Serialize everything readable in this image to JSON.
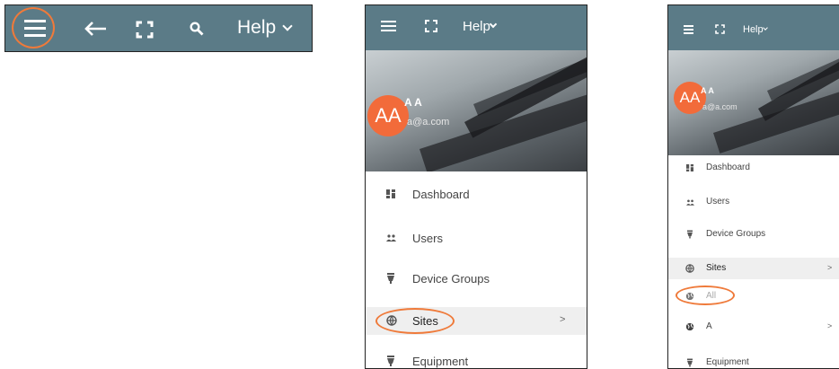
{
  "colors": {
    "toolbar_bg": "#5b7b87",
    "highlight_ring": "#ef7a3a",
    "avatar_bg": "#f26b3a",
    "active_row_bg": "#efefef"
  },
  "icons": {
    "menu": "hamburger-icon",
    "back": "arrow-left-icon",
    "fullscreen": "fullscreen-icon",
    "search": "search-icon",
    "help_chevron": "chevron-down-icon"
  },
  "toolbar": {
    "help_label": "Help"
  },
  "user": {
    "initials": "AA",
    "name": "A A",
    "email": "a@a.com"
  },
  "menu": {
    "dashboard": "Dashboard",
    "users": "Users",
    "device_groups": "Device Groups",
    "sites": "Sites",
    "sites_all": "All",
    "sites_a": "A",
    "equipment": "Equipment",
    "submenu_arrow": ">"
  }
}
